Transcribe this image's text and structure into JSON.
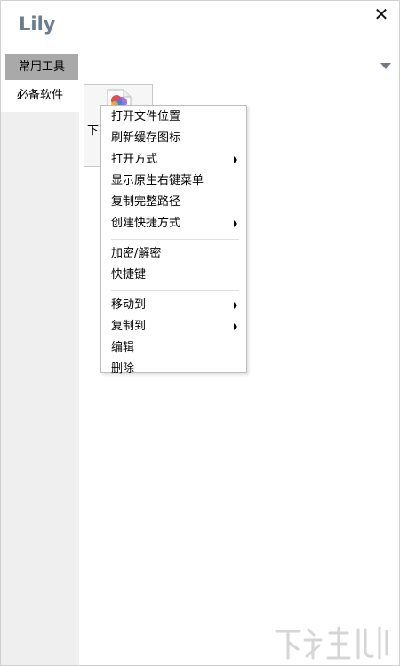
{
  "window": {
    "title": "Lily",
    "close_glyph": "✕"
  },
  "header": {
    "group_tab_label": "常用工具",
    "dropdown_icon": "triangle-down-icon"
  },
  "sidebar": {
    "items": [
      {
        "label": "必备软件",
        "active": true
      }
    ]
  },
  "content": {
    "file_tile": {
      "label": "下",
      "icon": "app-colorful-logo-icon"
    }
  },
  "context_menu": {
    "items": [
      {
        "label": "打开文件位置",
        "submenu": false
      },
      {
        "label": "刷新缓存图标",
        "submenu": false
      },
      {
        "label": "打开方式",
        "submenu": true
      },
      {
        "label": "显示原生右键菜单",
        "submenu": false
      },
      {
        "label": "复制完整路径",
        "submenu": false
      },
      {
        "label": "创建快捷方式",
        "submenu": true
      },
      {
        "label": "加密/解密",
        "submenu": false
      },
      {
        "label": "快捷键",
        "submenu": false
      },
      {
        "label": "移动到",
        "submenu": true
      },
      {
        "label": "复制到",
        "submenu": true
      },
      {
        "label": "编辑",
        "submenu": false
      },
      {
        "label": "删除",
        "submenu": false
      }
    ]
  },
  "colors": {
    "title_color": "#6b7d92",
    "tab_bg": "#a9a9a9",
    "sidebar_bg": "#efefef"
  }
}
